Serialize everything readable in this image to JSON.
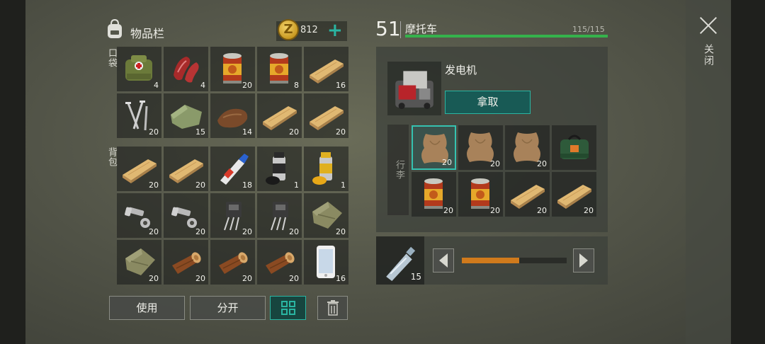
{
  "close": {
    "label": "关闭"
  },
  "inventory": {
    "title": "物品栏",
    "coins": "812",
    "pockets_label": "口袋",
    "backpack_label": "背包",
    "pockets": [
      {
        "item": "first-aid-kit",
        "qty": "4"
      },
      {
        "item": "raw-meat",
        "qty": "4"
      },
      {
        "item": "canned-food",
        "qty": "20"
      },
      {
        "item": "canned-food",
        "qty": "8"
      },
      {
        "item": "wood-plank",
        "qty": "16"
      },
      {
        "item": "nails",
        "qty": "20"
      },
      {
        "item": "cloth",
        "qty": "15"
      },
      {
        "item": "leather",
        "qty": "14"
      },
      {
        "item": "wood-plank",
        "qty": "20"
      },
      {
        "item": "wood-plank",
        "qty": "20"
      }
    ],
    "backpack": [
      {
        "item": "wood-plank",
        "qty": "20"
      },
      {
        "item": "wood-plank",
        "qty": "20"
      },
      {
        "item": "glue",
        "qty": "18"
      },
      {
        "item": "spray-paint-black",
        "qty": "1"
      },
      {
        "item": "spray-paint-yellow",
        "qty": "1"
      },
      {
        "item": "bolts",
        "qty": "20"
      },
      {
        "item": "bolts",
        "qty": "20"
      },
      {
        "item": "transistor",
        "qty": "20"
      },
      {
        "item": "transistor",
        "qty": "20"
      },
      {
        "item": "cloth-bundle",
        "qty": "20"
      },
      {
        "item": "cloth-bundle",
        "qty": "20"
      },
      {
        "item": "log",
        "qty": "20"
      },
      {
        "item": "log",
        "qty": "20"
      },
      {
        "item": "log",
        "qty": "20"
      },
      {
        "item": "smartphone",
        "qty": "16"
      }
    ],
    "buttons": {
      "use": "使用",
      "split": "分开"
    }
  },
  "vehicle": {
    "level": "51",
    "name": "摩托车",
    "hp_text": "115/115",
    "hp_fraction": 1.0,
    "slot_item": "generator",
    "slot_name": "发电机",
    "take_label": "拿取",
    "cargo_label": "行李",
    "cargo": [
      {
        "item": "animal-hide",
        "qty": "20",
        "selected": true
      },
      {
        "item": "animal-hide",
        "qty": "20"
      },
      {
        "item": "animal-hide",
        "qty": "20"
      },
      {
        "item": "green-bag",
        "qty": ""
      },
      {
        "item": "canned-food",
        "qty": "20"
      },
      {
        "item": "canned-food",
        "qty": "20"
      },
      {
        "item": "wood-plank",
        "qty": "20"
      },
      {
        "item": "wood-plank",
        "qty": "20"
      }
    ]
  },
  "transfer": {
    "item": "water-bottle",
    "qty": "15",
    "fraction": 0.55
  },
  "colors": {
    "accent": "#2ab5a2",
    "hp": "#35b24c",
    "slider": "#d07a1c"
  }
}
